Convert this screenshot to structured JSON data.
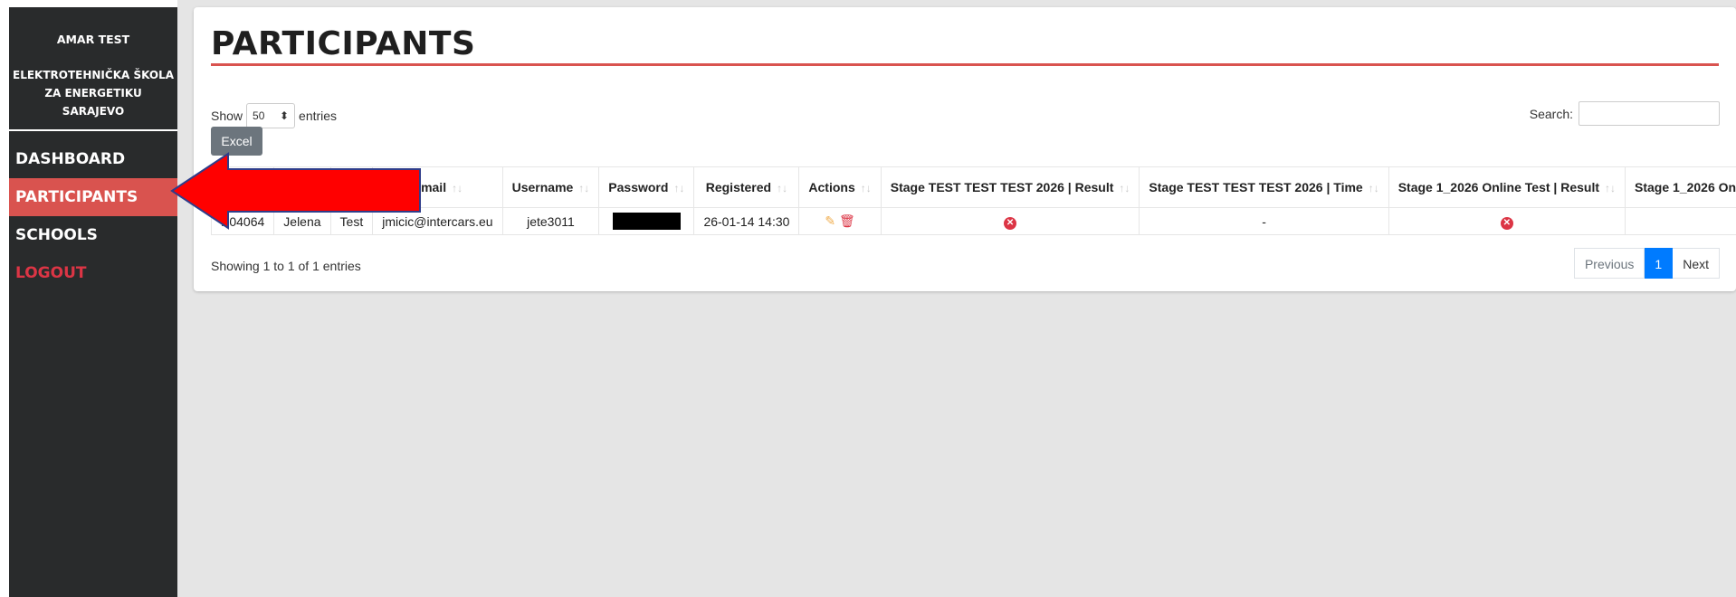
{
  "sidebar": {
    "user_name": "AMAR TEST",
    "school_name": "ELEKTROTEHNIČKA ŠKOLA ZA ENERGETIKU SARAJEVO",
    "items": [
      {
        "label": "DASHBOARD",
        "active": false
      },
      {
        "label": "PARTICIPANTS",
        "active": true
      },
      {
        "label": "SCHOOLS",
        "active": false
      },
      {
        "label": "LOGOUT",
        "active": false
      }
    ]
  },
  "page": {
    "title": "PARTICIPANTS"
  },
  "controls": {
    "show_label": "Show",
    "entries_label": "entries",
    "page_length": "50",
    "search_label": "Search:",
    "search_value": "",
    "excel_label": "Excel"
  },
  "table": {
    "columns": [
      "",
      "",
      "",
      "Email",
      "Username",
      "Password",
      "Registered",
      "Actions",
      "Stage TEST TEST TEST 2026 | Result",
      "Stage TEST TEST TEST 2026 | Time",
      "Stage 1_2026 Online Test | Result",
      "Stage 1_2026 On"
    ],
    "rows": [
      {
        "id": "P04064",
        "first_name": "Jelena",
        "last_name": "Test",
        "email": "jmicic@intercars.eu",
        "username": "jete3011",
        "registered": "26-01-14 14:30",
        "stage_test_time": "-"
      }
    ]
  },
  "footer": {
    "info": "Showing 1 to 1 of 1 entries",
    "previous_label": "Previous",
    "current_page": "1",
    "next_label": "Next"
  },
  "colors": {
    "sidebar_bg": "#292b2c",
    "active_item": "#d9534f",
    "logout": "#dc3545",
    "accent_line": "#d9534f",
    "pagination_active": "#007bff",
    "annotation_arrow": "#ff0000"
  },
  "icons": {
    "sort": "sort-icon",
    "edit": "edit-icon",
    "delete": "trash-icon",
    "fail": "x-circle-icon",
    "annotation": "red-arrow-icon"
  }
}
